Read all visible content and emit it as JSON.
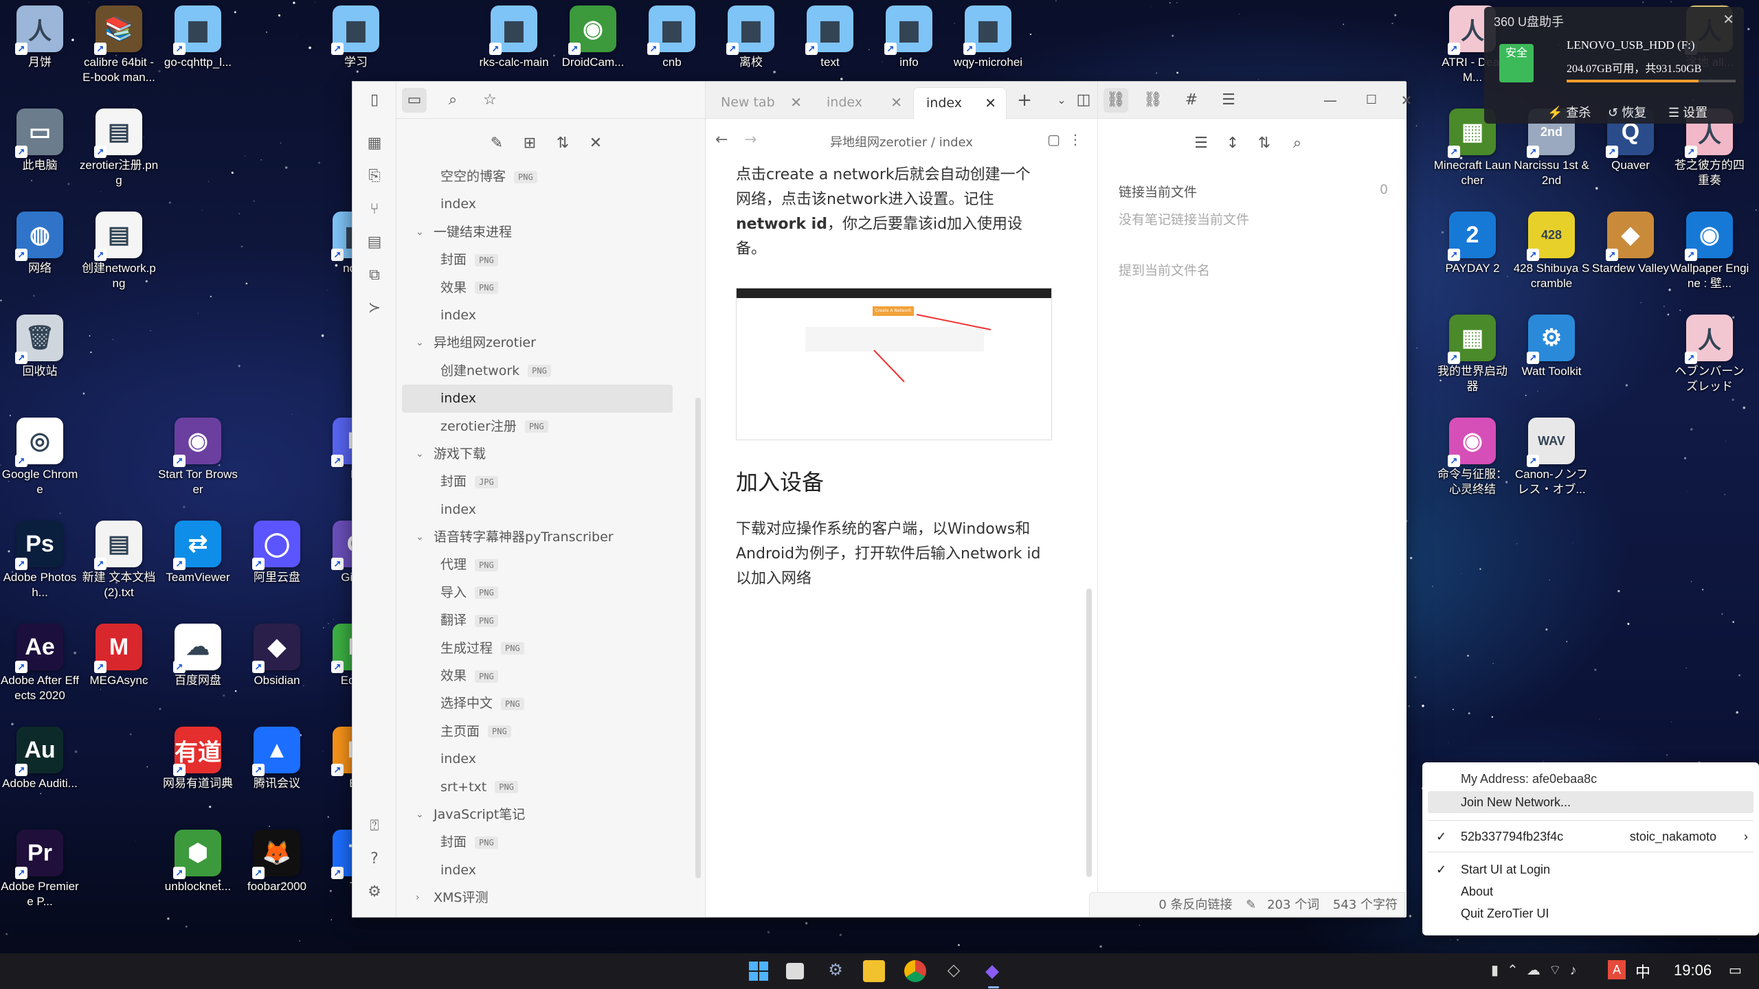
{
  "desktop": {
    "icons": [
      {
        "label": "月饼",
        "color": "#9bb6d8",
        "glyph": "人"
      },
      {
        "label": "calibre 64bit - E-book man...",
        "color": "#6b4f2a",
        "glyph": "📚"
      },
      {
        "label": "go-cqhttp_l...",
        "color": "#7fc4f7",
        "glyph": "▆"
      },
      {
        "label": "学习",
        "color": "#7fc4f7",
        "glyph": "▆"
      },
      {
        "label": "rks-calc-main",
        "color": "#7fc4f7",
        "glyph": "▆"
      },
      {
        "label": "DroidCam...",
        "color": "#3c9a3c",
        "glyph": "◉"
      },
      {
        "label": "cnb",
        "color": "#7fc4f7",
        "glyph": "▆"
      },
      {
        "label": "离校",
        "color": "#7fc4f7",
        "glyph": "▆"
      },
      {
        "label": "text",
        "color": "#7fc4f7",
        "glyph": "▆"
      },
      {
        "label": "info",
        "color": "#7fc4f7",
        "glyph": "▆"
      },
      {
        "label": "wqy-microhei",
        "color": "#7fc4f7",
        "glyph": "▆"
      },
      {
        "label": "此电脑",
        "color": "#6b7c8c",
        "glyph": "▭"
      },
      {
        "label": "zerotier注册.png",
        "color": "#f5f5f5",
        "glyph": "▤"
      },
      {
        "label": "网络",
        "color": "#2f74c9",
        "glyph": "◍"
      },
      {
        "label": "创建network.png",
        "color": "#f5f5f5",
        "glyph": "▤"
      },
      {
        "label": "none",
        "color": "#7fc4f7",
        "glyph": "▆"
      },
      {
        "label": "回收站",
        "color": "#cfd6de",
        "glyph": "🗑"
      },
      {
        "label": "Google Chrome",
        "color": "#ffffff",
        "glyph": "◎"
      },
      {
        "label": "Start Tor Browser",
        "color": "#6b3fa0",
        "glyph": "◉"
      },
      {
        "label": "Di",
        "color": "#5865f2",
        "glyph": "D"
      },
      {
        "label": "Adobe Photosh...",
        "color": "#0a1f3d",
        "glyph": "Ps"
      },
      {
        "label": "新建 文本文档 (2).txt",
        "color": "#f3f3f3",
        "glyph": "▤"
      },
      {
        "label": "TeamViewer",
        "color": "#0e8ee9",
        "glyph": "⇄"
      },
      {
        "label": "阿里云盘",
        "color": "#5b55ff",
        "glyph": "◯"
      },
      {
        "label": "Gi De",
        "color": "#6b4fbb",
        "glyph": "G"
      },
      {
        "label": "Adobe After Effects 2020",
        "color": "#1d0f3d",
        "glyph": "Ae"
      },
      {
        "label": "MEGAsync",
        "color": "#d9272e",
        "glyph": "M"
      },
      {
        "label": "百度网盘",
        "color": "#ffffff",
        "glyph": "☁"
      },
      {
        "label": "Obsidian",
        "color": "#2a1f4a",
        "glyph": "◆"
      },
      {
        "label": "Edrav",
        "color": "#3cb043",
        "glyph": "E"
      },
      {
        "label": "Adobe Auditi...",
        "color": "#0d2a2a",
        "glyph": "Au"
      },
      {
        "label": "网易有道词典",
        "color": "#e52e2e",
        "glyph": "有道"
      },
      {
        "label": "腾讯会议",
        "color": "#1c6eff",
        "glyph": "▲"
      },
      {
        "label": "Bit",
        "color": "#f7931a",
        "glyph": "B"
      },
      {
        "label": "Adobe Premiere P...",
        "color": "#1f0f3a",
        "glyph": "Pr"
      },
      {
        "label": "unblocknet...",
        "color": "#3c9a3c",
        "glyph": "⬢"
      },
      {
        "label": "foobar2000",
        "color": "#101010",
        "glyph": "🦊"
      },
      {
        "label": "Te",
        "color": "#1c6eff",
        "glyph": "T"
      },
      {
        "label": "ATRI - Dear M...",
        "color": "#f2c7d2",
        "glyph": "人"
      },
      {
        "label": "涂地 all...",
        "color": "#d7c46b",
        "glyph": "人"
      },
      {
        "label": "Minecraft Launcher",
        "color": "#4a8a2a",
        "glyph": "▦"
      },
      {
        "label": "Narcissu 1st & 2nd",
        "color": "#9aa9bf",
        "glyph": "2nd"
      },
      {
        "label": "Quaver",
        "color": "#2b4c8a",
        "glyph": "Q"
      },
      {
        "label": "苍之彼方的四重奏",
        "color": "#f2b8c8",
        "glyph": "人"
      },
      {
        "label": "PAYDAY 2",
        "color": "#1679d6",
        "glyph": "2"
      },
      {
        "label": "428 Shibuya Scramble",
        "color": "#e8d02a",
        "glyph": "428"
      },
      {
        "label": "Stardew Valley",
        "color": "#c98b3a",
        "glyph": "◆"
      },
      {
        "label": "Wallpaper Engine : 壁...",
        "color": "#1679d6",
        "glyph": "◉"
      },
      {
        "label": "我的世界启动器",
        "color": "#4a8a2a",
        "glyph": "▦"
      },
      {
        "label": "Watt Toolkit",
        "color": "#2a8ad9",
        "glyph": "⚙"
      },
      {
        "label": "ヘブンバーンズレッド",
        "color": "#f2c7d2",
        "glyph": "人"
      },
      {
        "label": "命令与征服：心灵终结",
        "color": "#d64fb8",
        "glyph": "◉"
      },
      {
        "label": "Canon-ノンフレス・オブ...",
        "color": "#e8e8e8",
        "glyph": "WAV"
      }
    ]
  },
  "popup360": {
    "title": "360 U盘助手",
    "badge": "安全",
    "drive": "LENOVO_USB_HDD (F:)",
    "space": "204.07GB可用，共931.50GB",
    "actions": [
      "查杀",
      "恢复",
      "设置"
    ]
  },
  "obsidian": {
    "ribbon_icons": [
      "layout-icon",
      "graph-icon",
      "template-icon",
      "calendar-icon",
      "copy-icon",
      "terminal-icon",
      "help-icon",
      "settings-icon"
    ],
    "file_tree": [
      {
        "type": "note",
        "label": "空空的博客",
        "badge": "PNG"
      },
      {
        "type": "note",
        "label": "index",
        "badge": ""
      },
      {
        "type": "folder",
        "label": "一键结束进程"
      },
      {
        "type": "note",
        "label": "封面",
        "badge": "PNG"
      },
      {
        "type": "note",
        "label": "效果",
        "badge": "PNG"
      },
      {
        "type": "note",
        "label": "index",
        "badge": ""
      },
      {
        "type": "folder",
        "label": "异地组网zerotier"
      },
      {
        "type": "note",
        "label": "创建network",
        "badge": "PNG"
      },
      {
        "type": "note",
        "label": "index",
        "badge": "",
        "selected": true
      },
      {
        "type": "note",
        "label": "zerotier注册",
        "badge": "PNG"
      },
      {
        "type": "folder",
        "label": "游戏下载"
      },
      {
        "type": "note",
        "label": "封面",
        "badge": "JPG"
      },
      {
        "type": "note",
        "label": "index",
        "badge": ""
      },
      {
        "type": "folder",
        "label": "语音转字幕神器pyTranscriber"
      },
      {
        "type": "note",
        "label": "代理",
        "badge": "PNG"
      },
      {
        "type": "note",
        "label": "导入",
        "badge": "PNG"
      },
      {
        "type": "note",
        "label": "翻译",
        "badge": "PNG"
      },
      {
        "type": "note",
        "label": "生成过程",
        "badge": "PNG"
      },
      {
        "type": "note",
        "label": "效果",
        "badge": "PNG"
      },
      {
        "type": "note",
        "label": "选择中文",
        "badge": "PNG"
      },
      {
        "type": "note",
        "label": "主页面",
        "badge": "PNG"
      },
      {
        "type": "note",
        "label": "index",
        "badge": ""
      },
      {
        "type": "note",
        "label": "srt+txt",
        "badge": "PNG"
      },
      {
        "type": "folder",
        "label": "JavaScript笔记"
      },
      {
        "type": "note",
        "label": "封面",
        "badge": "PNG"
      },
      {
        "type": "note",
        "label": "index",
        "badge": ""
      },
      {
        "type": "folder-collapsed",
        "label": "XMS评测"
      }
    ],
    "tabs": [
      {
        "label": "New tab"
      },
      {
        "label": "index"
      },
      {
        "label": "index",
        "active": true
      }
    ],
    "breadcrumb": {
      "folder": "异地组网zerotier",
      "sep": "/",
      "file": "index"
    },
    "content": {
      "para1_pre": "点击create a network后就会自动创建一个网络，点击该network进入设置。记住",
      "para1_bold": "network id",
      "para1_post": "，你之后要靠该id加入使用设备。",
      "image_caption": "Create A Network",
      "heading": "加入设备",
      "para2": "下载对应操作系统的客户端，以Windows和Android为例子，打开软件后输入network id以加入网络"
    },
    "right": {
      "backlinks_title": "链接当前文件",
      "backlinks_count": "0",
      "backlinks_empty": "没有笔记链接当前文件",
      "mentions_title": "提到当前文件名"
    },
    "status": {
      "backlinks": "0 条反向链接",
      "words": "203 个词",
      "chars": "543 个字符"
    }
  },
  "zerotier_menu": {
    "address": "My Address:  afe0ebaa8c",
    "join": "Join New Network...",
    "network_id": "52b337794fb23f4c",
    "network_name": "stoic_nakamoto",
    "start_at_login": "Start UI at Login",
    "about": "About",
    "quit": "Quit ZeroTier UI"
  },
  "taskbar": {
    "clock": "19:06"
  }
}
